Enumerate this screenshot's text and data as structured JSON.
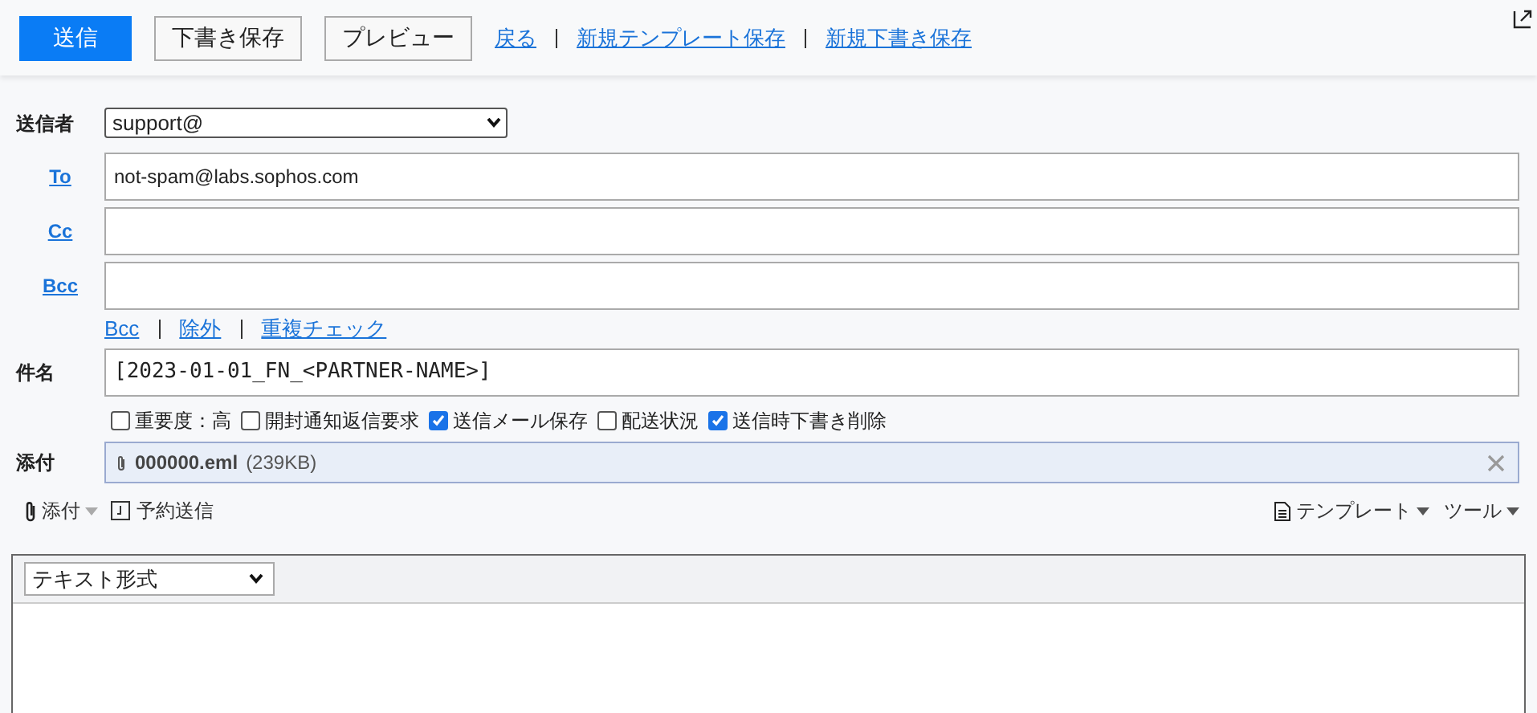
{
  "toolbar": {
    "buttons": [
      {
        "label": "送信",
        "kind": "primary"
      },
      {
        "label": "下書き保存",
        "kind": "plain"
      },
      {
        "label": "プレビュー",
        "kind": "plain"
      }
    ],
    "links": [
      "戻る",
      "新規テンプレート保存",
      "新規下書き保存"
    ]
  },
  "sender": {
    "label": "送信者",
    "value": "support@"
  },
  "recipients": [
    {
      "label": "To",
      "value": "not-spam@labs.sophos.com"
    },
    {
      "label": "Cc"
    },
    {
      "label": "Bcc"
    }
  ],
  "address_links": [
    "Bcc",
    "除外",
    "重複チェック"
  ],
  "subject": {
    "label": "件名",
    "value": "[2023-01-01_FN_<PARTNER-NAME>]"
  },
  "options": [
    {
      "label": "重要度：高",
      "checked": false
    },
    {
      "label": "開封通知返信要求",
      "checked": false
    },
    {
      "label": "送信メール保存",
      "checked": true
    },
    {
      "label": "配送状況",
      "checked": false
    },
    {
      "label": "送信時下書き削除",
      "checked": true
    }
  ],
  "attachment": {
    "label": "添付",
    "file": "000000.eml",
    "size": "(239KB)"
  },
  "actions": {
    "attach": "添付",
    "schedule": "予約送信",
    "template": "テンプレート",
    "tools": "ツール"
  },
  "editor": {
    "format": "テキスト形式"
  }
}
